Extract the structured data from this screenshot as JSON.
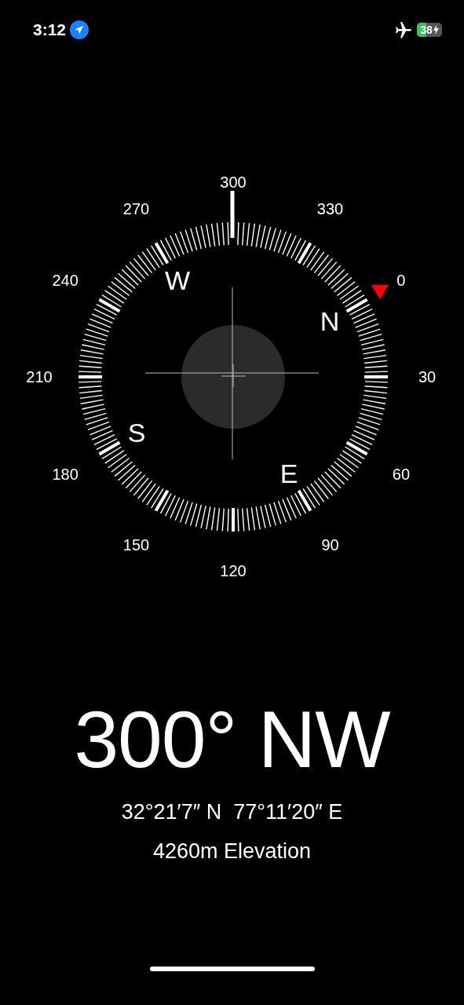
{
  "status_bar": {
    "time": "3:12",
    "battery": "38"
  },
  "compass": {
    "degree_labels": [
      "300",
      "330",
      "0",
      "30",
      "60",
      "90",
      "120",
      "150",
      "180",
      "210",
      "240",
      "270"
    ],
    "cardinals": [
      "N",
      "E",
      "S",
      "W"
    ]
  },
  "heading": "300° NW",
  "coordinates": "32°21′7″ N  77°11′20″ E",
  "elevation": "4260m Elevation"
}
